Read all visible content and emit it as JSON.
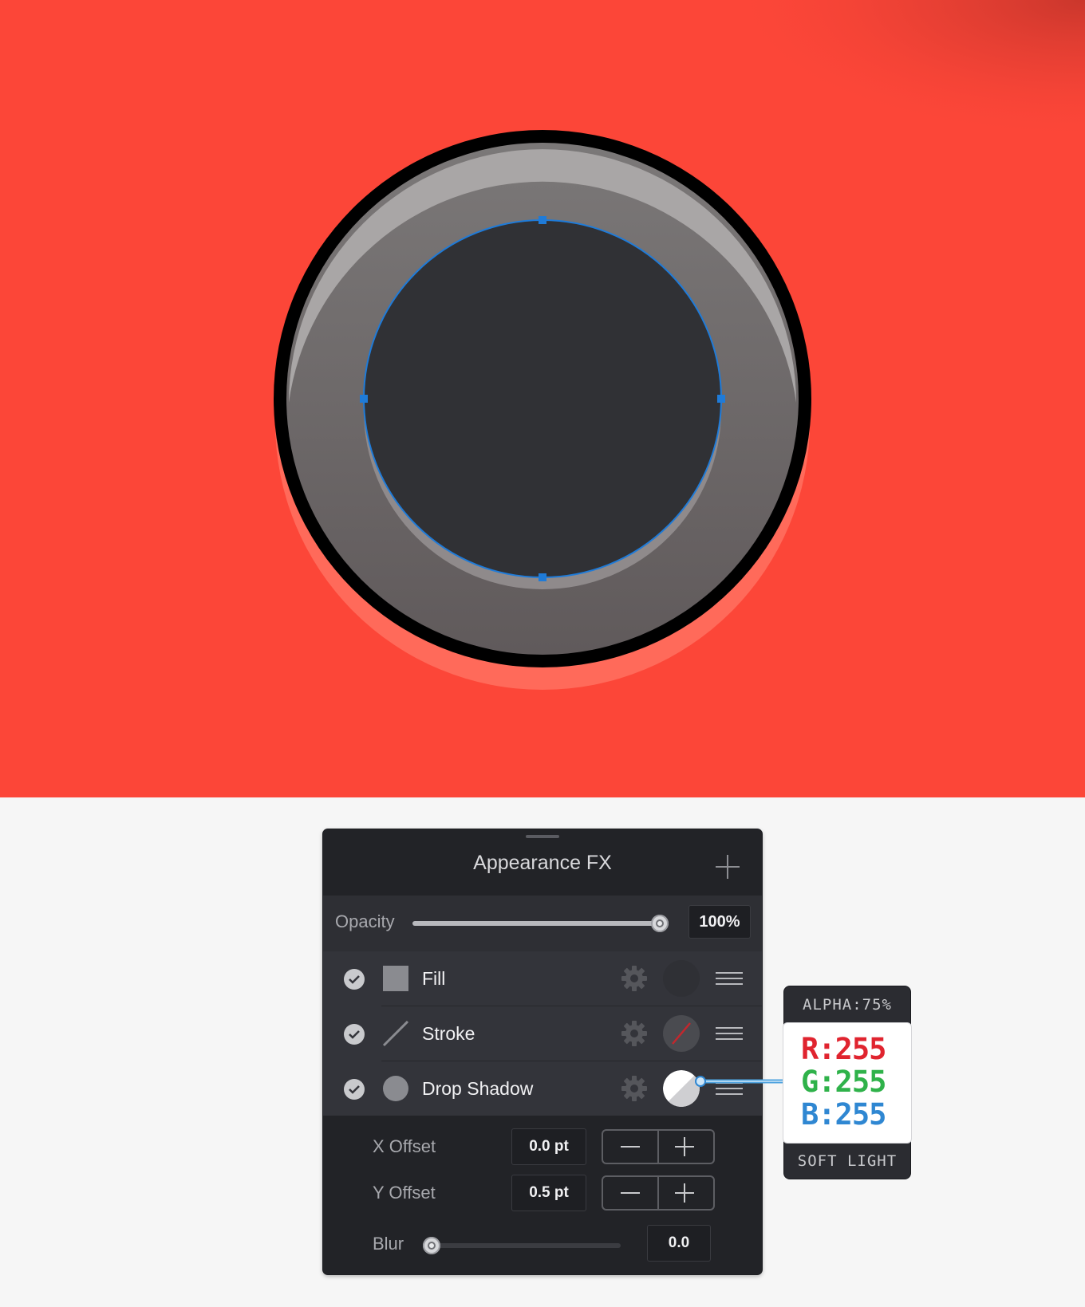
{
  "canvas": {
    "background_color": "#fc4638",
    "button_ring_color": "#000000",
    "button_face_color": "#6f6b6b",
    "button_center_color": "#303135",
    "selection_color": "#1f7bd8",
    "shadow_color": "#ff6a5a"
  },
  "panel": {
    "title": "Appearance FX",
    "add_icon": "plus-icon",
    "opacity": {
      "label": "Opacity",
      "value": "100%",
      "level": 1.0
    },
    "layers": [
      {
        "label": "Fill",
        "icon": "square-fill-icon",
        "checked": true,
        "swatch": "#2f3035"
      },
      {
        "label": "Stroke",
        "icon": "stroke-line-icon",
        "checked": true,
        "swatch": "none"
      },
      {
        "label": "Drop Shadow",
        "icon": "circle-shadow-icon",
        "checked": true,
        "swatch": "#ffffff"
      }
    ],
    "x_offset": {
      "label": "X Offset",
      "value": "0.0 pt"
    },
    "y_offset": {
      "label": "Y Offset",
      "value": "0.5 pt"
    },
    "blur": {
      "label": "Blur",
      "value": "0.0",
      "level": 0.0
    }
  },
  "color_callout": {
    "alpha": "ALPHA:75%",
    "r": "R:255",
    "g": "G:255",
    "b": "B:255",
    "blend_mode": "SOFT LIGHT",
    "r_color": "#e0242f",
    "g_color": "#2fb24a",
    "b_color": "#2f87d2"
  }
}
